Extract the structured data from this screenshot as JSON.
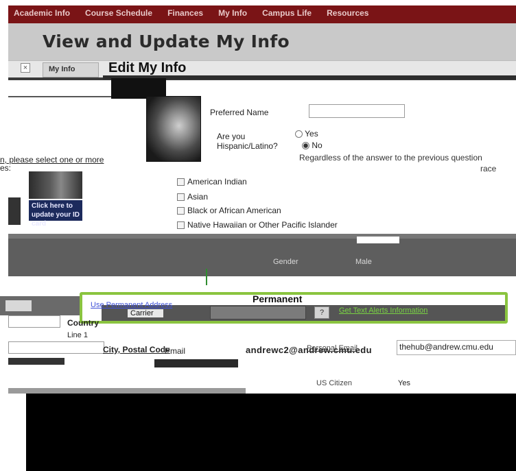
{
  "topnav": {
    "items": [
      "Academic Info",
      "Course Schedule",
      "Finances",
      "My Info",
      "Campus Life",
      "Resources"
    ]
  },
  "page": {
    "title": "View and Update My Info",
    "tab_label": "My Info",
    "close_glyph": "×"
  },
  "modal": {
    "title": "Edit My Info",
    "preferred_name_label": "Preferred Name",
    "hispanic_question": "Are you Hispanic/Latino?",
    "radio_yes": "Yes",
    "radio_no": "No",
    "hispanic_selected": "No",
    "regardless_text": "Regardless of the answer to the previous question",
    "race_word": "race",
    "race_prompt_a": "n, please select one or more",
    "race_prompt_b": "es:",
    "race_options": [
      "American Indian",
      "Asian",
      "Black or African American",
      "Native Hawaiian or Other Pacific Islander"
    ],
    "click_here_text": "Click here to update your ID card"
  },
  "demographics": {
    "gender_header": "Gender",
    "gender_value": "Male",
    "permanent_label": "Permanent"
  },
  "phone": {
    "address_link": "Use Permanent Address",
    "carrier_label": "Carrier",
    "help_button": "?",
    "gsms_link": "Get Text Alerts Information"
  },
  "address": {
    "country_label": "Country",
    "line1_label": "Line 1",
    "city_postal_label": "City, Postal Code"
  },
  "contact": {
    "email_label": "Email",
    "email_value": "andrewc2@andrew.cmu.edu",
    "alt_email_label": "Personal Email",
    "alt_email_value": "thehub@andrew.cmu.edu",
    "us_citizen_label": "US Citizen",
    "us_citizen_value": "Yes"
  },
  "colors": {
    "nav_maroon": "#7a1416",
    "highlight_green": "#8ac43f",
    "header_grey": "#c9c9c9"
  }
}
